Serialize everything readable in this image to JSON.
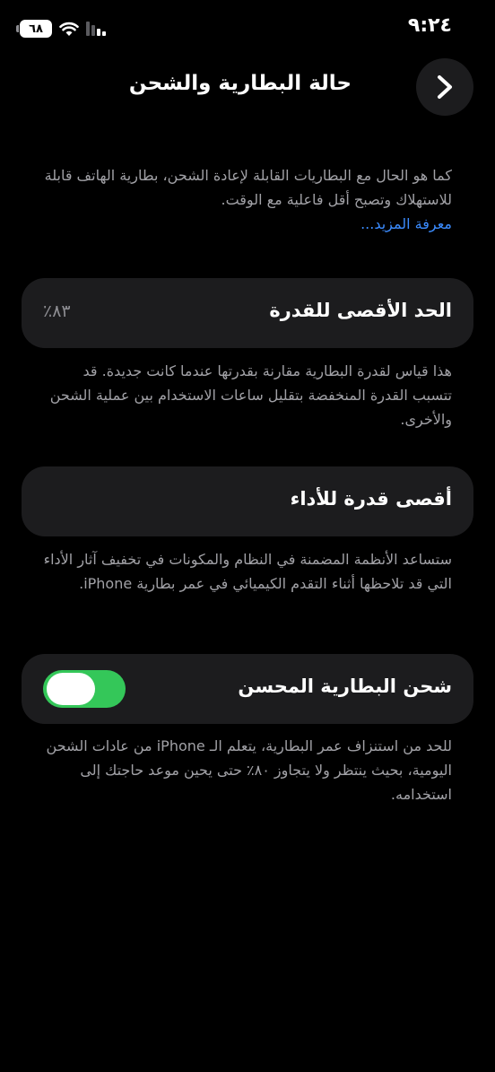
{
  "status_bar": {
    "time": "٩:٢٤",
    "battery_level": "٦٨"
  },
  "header": {
    "title": "حالة البطارية والشحن",
    "back_icon": "chevron-right-icon"
  },
  "intro": {
    "text": "كما هو الحال مع البطاريات القابلة لإعادة الشحن، بطارية الهاتف قابلة للاستهلاك وتصبح أقل فاعلية مع الوقت.",
    "learn_more": "معرفة المزيد..."
  },
  "max_capacity": {
    "label": "الحد الأقصى للقدرة",
    "value": "٨٣٪",
    "description": "هذا قياس لقدرة البطارية مقارنة بقدرتها عندما كانت جديدة. قد تتسبب القدرة المنخفضة بتقليل ساعات الاستخدام بين عملية الشحن والأخرى."
  },
  "peak_performance": {
    "label": "أقصى قدرة للأداء",
    "description": "ستساعد الأنظمة المضمنة في النظام والمكونات في تخفيف آثار الأداء التي قد تلاحظها أثناء التقدم الكيميائي في عمر بطارية iPhone."
  },
  "optimized_charging": {
    "label": "شحن البطارية المحسن",
    "enabled": true,
    "toggle_color": "#34c759",
    "description": "للحد من استنزاف عمر البطارية، يتعلم الـ iPhone من عادات الشحن اليومية، بحيث ينتظر ولا يتجاوز ٨٠٪ حتى يحين موعد حاجتك إلى استخدامه."
  },
  "colors": {
    "background": "#000000",
    "card": "#1c1c1e",
    "secondary_text": "#a1a1a6",
    "link": "#3b8cff"
  }
}
